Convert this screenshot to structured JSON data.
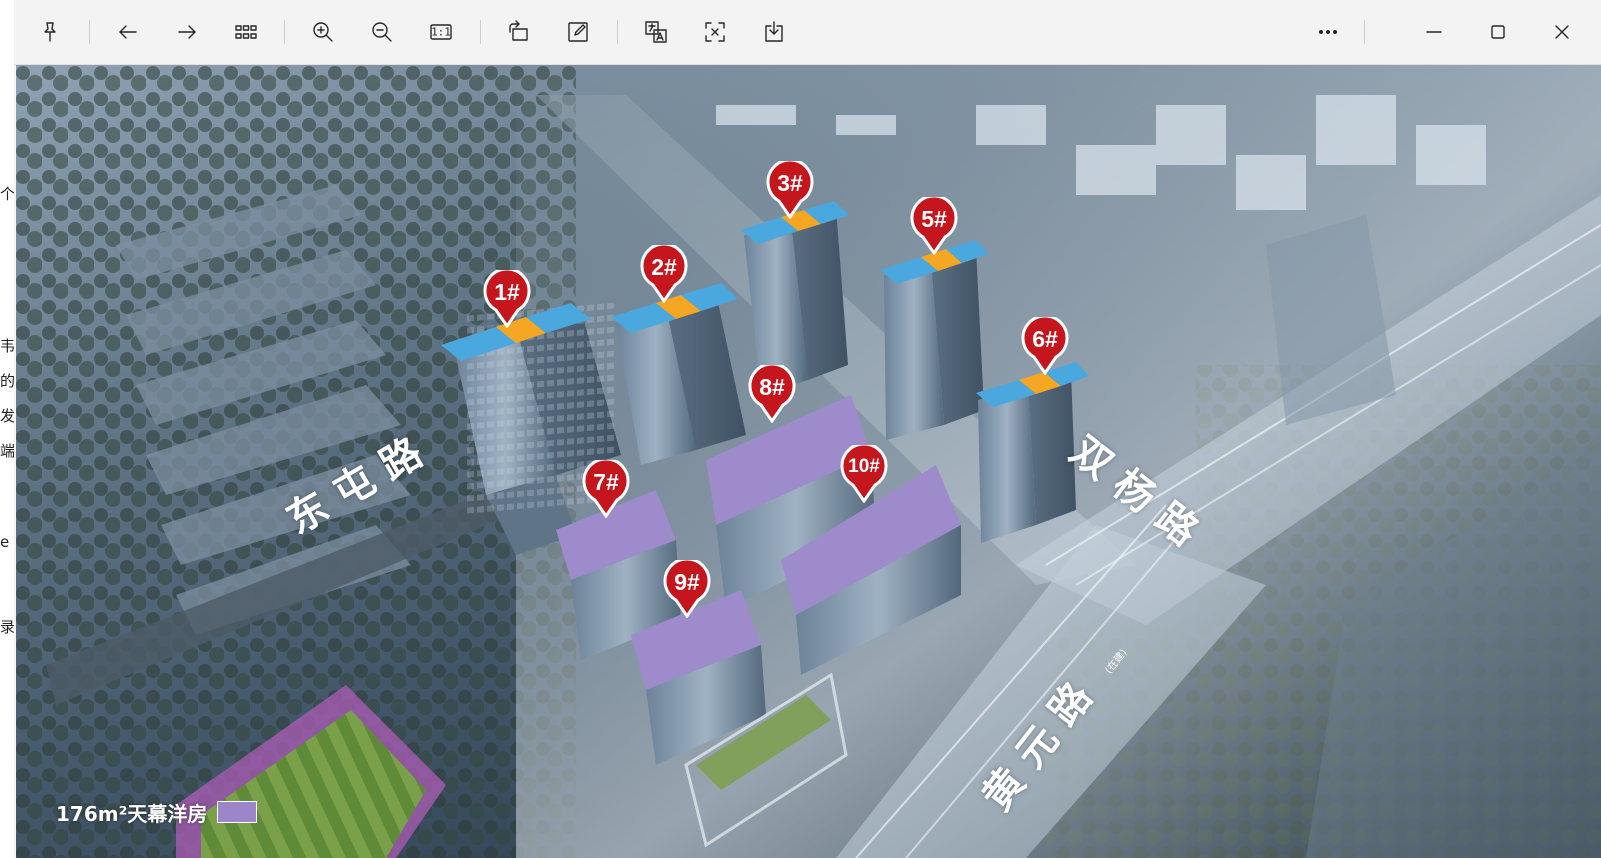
{
  "toolbar": {
    "pin_icon": "pin-icon",
    "back_icon": "arrow-left-icon",
    "forward_icon": "arrow-right-icon",
    "grid_icon": "grid-icon",
    "zoom_in_icon": "zoom-in-icon",
    "zoom_out_icon": "zoom-out-icon",
    "actual_size_label": "1:1",
    "rotate_icon": "rotate-icon",
    "edit_icon": "edit-icon",
    "translate_icon": "translate-icon",
    "ocr_icon": "text-recognize-icon",
    "download_icon": "download-icon",
    "more_label": "···",
    "minimize_icon": "minimize-icon",
    "maximize_icon": "maximize-icon",
    "close_icon": "close-icon"
  },
  "left_strip": {
    "chars": [
      "个",
      "韦",
      "的",
      "发",
      "端",
      "e",
      "录"
    ]
  },
  "image": {
    "buildings": [
      {
        "id": "b1",
        "label": "1#"
      },
      {
        "id": "b2",
        "label": "2#"
      },
      {
        "id": "b3",
        "label": "3#"
      },
      {
        "id": "b5",
        "label": "5#"
      },
      {
        "id": "b6",
        "label": "6#"
      },
      {
        "id": "b7",
        "label": "7#"
      },
      {
        "id": "b8",
        "label": "8#"
      },
      {
        "id": "b9",
        "label": "9#"
      },
      {
        "id": "b10",
        "label": "10#"
      }
    ],
    "roads": {
      "dongtun": "东屯路",
      "shuangyang": "双杨路",
      "huangyuan": "黄元路",
      "huangyuan_note": "(在建)"
    },
    "legend": {
      "label": "176m²天幕洋房",
      "color": "#9a86c9"
    },
    "colors": {
      "marker_red": "#c4161c",
      "roof_blue": "#4aa8df",
      "roof_orange": "#f5a623",
      "roof_purple": "#9a86c9"
    }
  }
}
